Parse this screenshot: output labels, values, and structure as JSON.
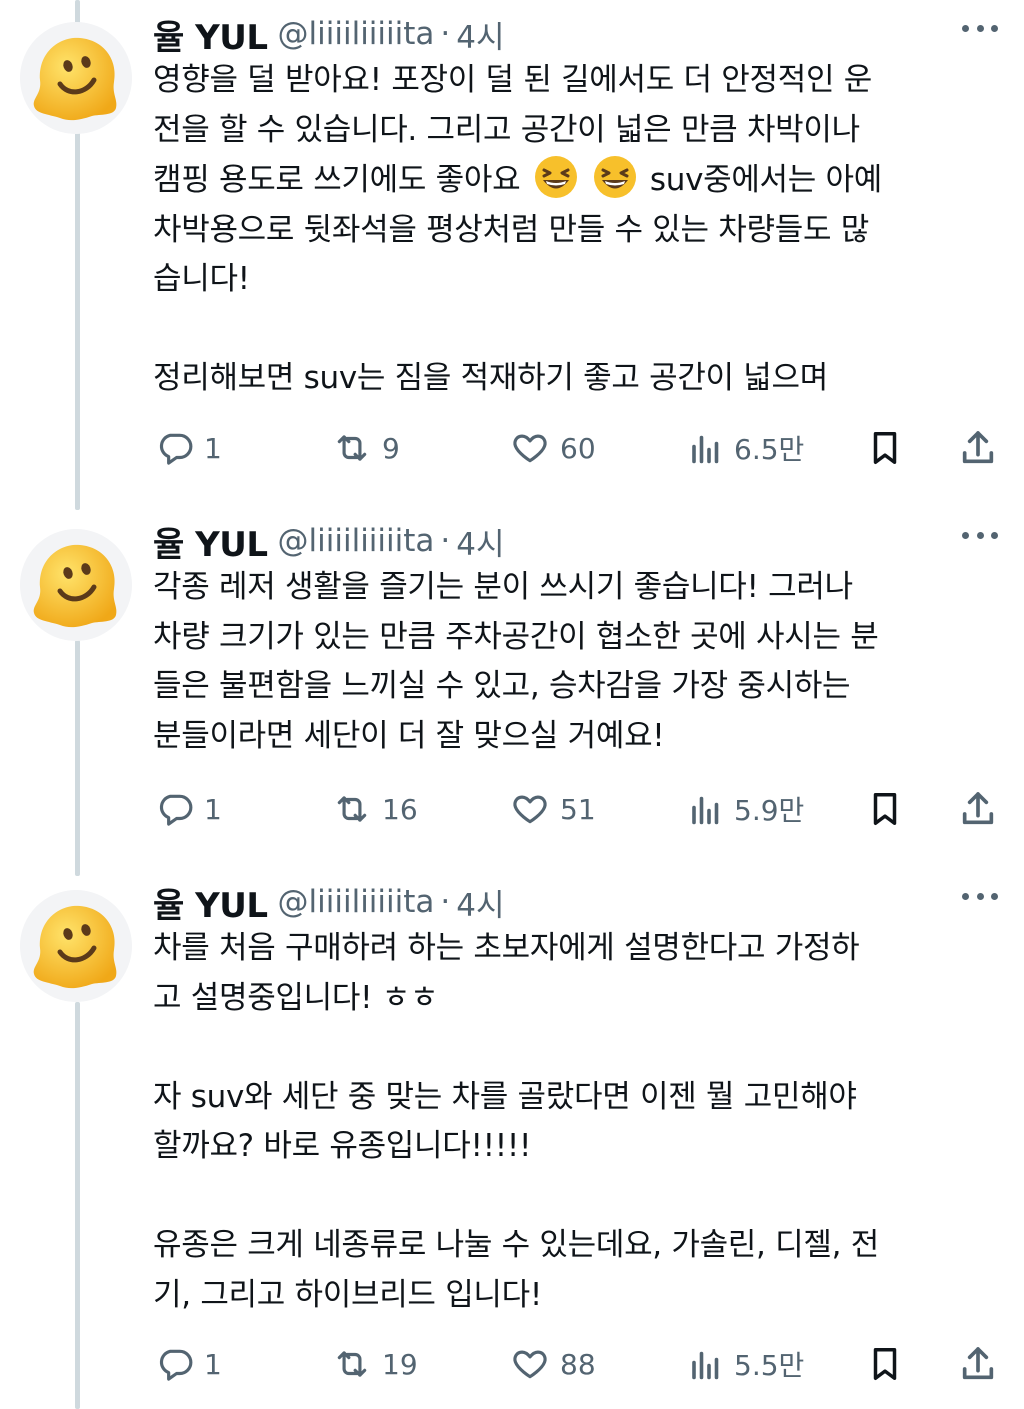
{
  "tweets": [
    {
      "name": "율 YUL",
      "handle": "@liiiiliiiiita",
      "separator": "·",
      "time": "4시",
      "lines": [
        "영향을 덜 받아요! 포장이 덜 된 길에서도 더 안정적인 운",
        "전을 할 수 있습니다. 그리고 공간이 넓은 만큼 차박이나",
        "캠핑 용도로 쓰기에도 좋아요",
        " suv중에서는 아예",
        "차박용으로 뒷좌석을 평상처럼 만들 수 있는 차량들도 많",
        "습니다!",
        "",
        "정리해보면 suv는 짐을 적재하기 좋고 공간이 넓으며"
      ],
      "emoji": "grinning-squinting-face",
      "stats": {
        "replies": "1",
        "reposts": "9",
        "likes": "60",
        "views": "6.5만"
      }
    },
    {
      "name": "율 YUL",
      "handle": "@liiiiliiiiita",
      "separator": "·",
      "time": "4시",
      "lines": [
        "각종 레저 생활을 즐기는 분이 쓰시기 좋습니다! 그러나",
        "차량 크기가 있는 만큼 주차공간이 협소한 곳에 사시는 분",
        "들은 불편함을 느끼실 수 있고, 승차감을 가장 중시하는",
        "분들이라면 세단이 더 잘 맞으실 거예요!"
      ],
      "stats": {
        "replies": "1",
        "reposts": "16",
        "likes": "51",
        "views": "5.9만"
      }
    },
    {
      "name": "율 YUL",
      "handle": "@liiiiliiiiita",
      "separator": "·",
      "time": "4시",
      "lines": [
        "차를 처음 구매하려 하는 초보자에게 설명한다고 가정하",
        "고 설명중입니다! ㅎㅎ",
        "",
        "자 suv와 세단 중 맞는 차를 골랐다면 이젠 뭘 고민해야",
        "할까요? 바로 유종입니다!!!!!",
        "",
        "유종은 크게 네종류로 나눌 수 있는데요, 가솔린, 디젤, 전",
        "기, 그리고 하이브리드 입니다!"
      ],
      "stats": {
        "replies": "1",
        "reposts": "19",
        "likes": "88",
        "views": "5.5만"
      }
    }
  ],
  "colors": {
    "text": "#0f1419",
    "secondary": "#536471",
    "thread_line": "#cfd9de",
    "avatar_yellow": "#f7c02b",
    "background": "#ffffff"
  },
  "icons": [
    "melting-face-avatar",
    "more-icon",
    "reply-icon",
    "repost-icon",
    "like-icon",
    "views-icon",
    "bookmark-icon",
    "share-icon"
  ]
}
